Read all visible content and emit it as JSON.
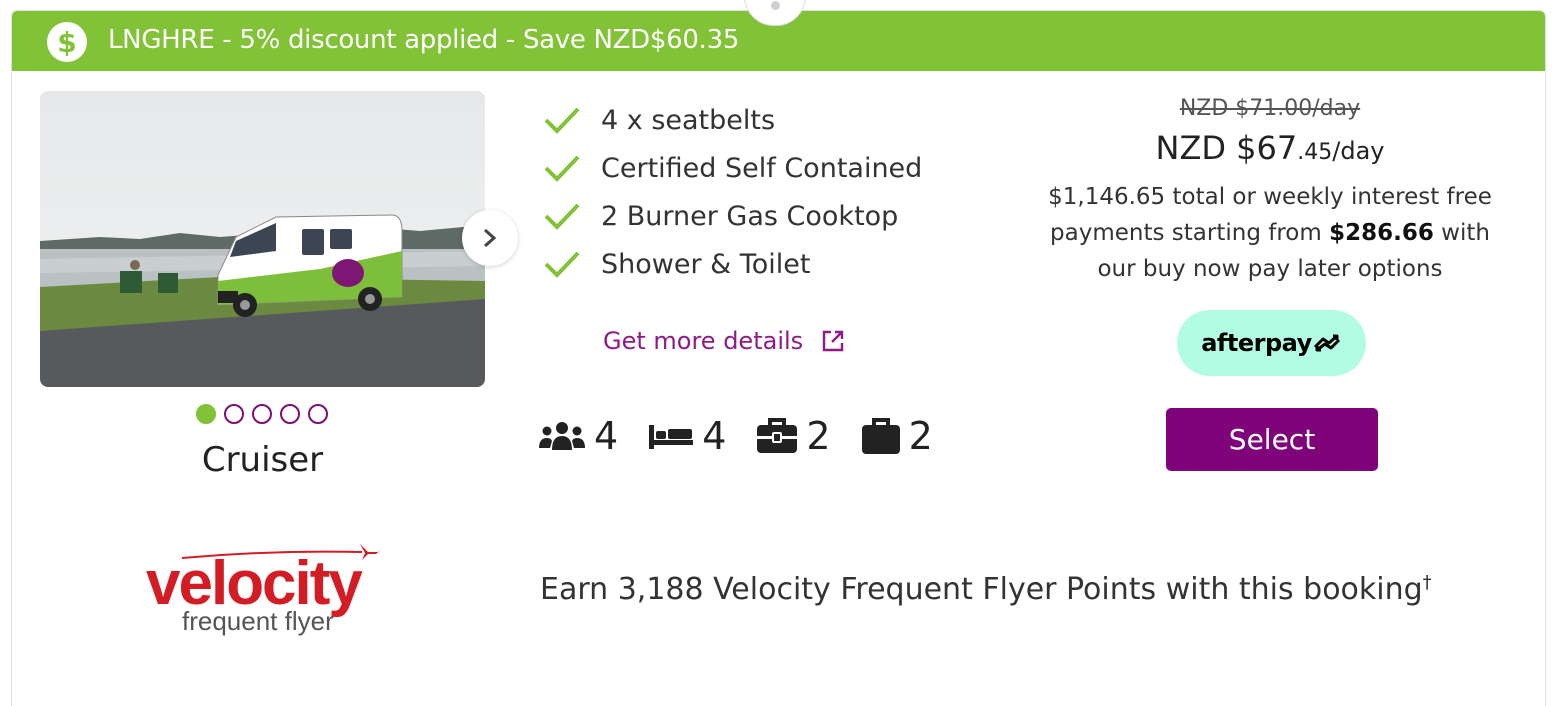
{
  "banner": {
    "icon": "dollar-circle-icon",
    "text": "LNGHRE - 5% discount applied - Save NZD$60.35",
    "color": "#82c237"
  },
  "vehicle": {
    "name": "Cruiser",
    "carousel": {
      "total": 5,
      "active_index": 0
    }
  },
  "features": [
    {
      "label": "4 x seatbelts"
    },
    {
      "label": "Certified Self Contained"
    },
    {
      "label": "2 Burner Gas Cooktop"
    },
    {
      "label": "Shower & Toilet"
    }
  ],
  "details_link": "Get more details",
  "capacity": {
    "passengers": "4",
    "beds": "4",
    "large_bags": "2",
    "small_bags": "2"
  },
  "pricing": {
    "old_price": "NZD $71.00/day",
    "price_main": "NZD $67",
    "price_cents": ".45",
    "price_per": "/day",
    "total_text": "$1,146.65 total or weekly interest free payments starting from ",
    "installment": "$286.66",
    "tail_text": " with our buy now pay later options"
  },
  "afterpay": {
    "label": "afterpay",
    "color": "#b2fce4"
  },
  "select_label": "Select",
  "velocity": {
    "logo_word": "velocity",
    "logo_sub": "frequent flyer",
    "earn_text": "Earn 3,188 Velocity Frequent Flyer Points with this booking",
    "earn_mark": "†"
  },
  "colors": {
    "brand_purple": "#800479",
    "brand_green": "#82c237"
  }
}
